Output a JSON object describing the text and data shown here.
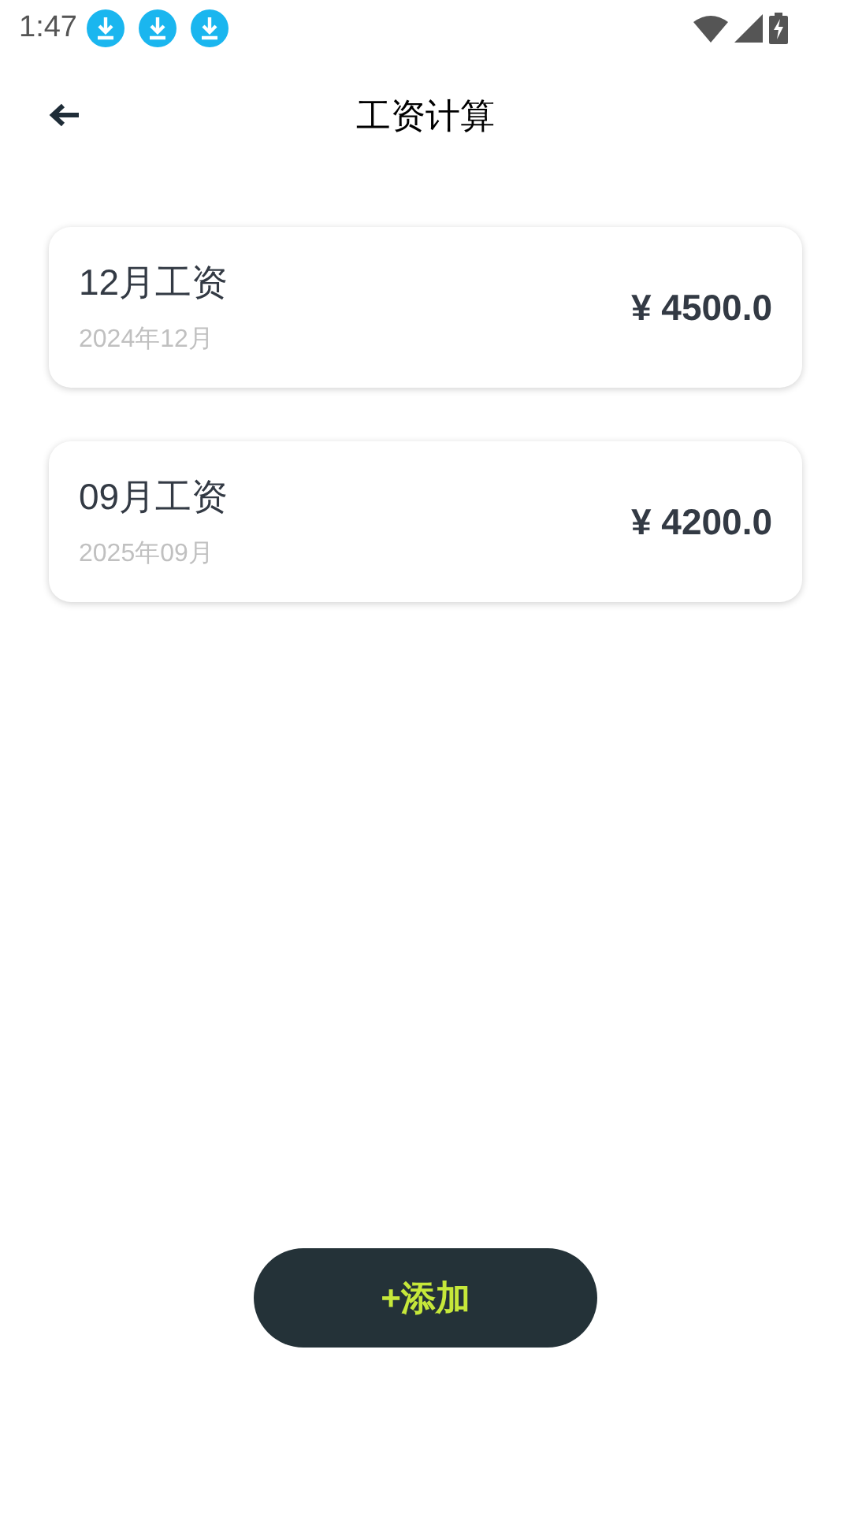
{
  "status_bar": {
    "time": "1:47",
    "notifications": [
      {
        "kind": "download"
      },
      {
        "kind": "download"
      },
      {
        "kind": "download"
      }
    ]
  },
  "header": {
    "title": "工资计算"
  },
  "salaries": [
    {
      "title": "12月工资",
      "date": "2024年12月",
      "amount": "¥ 4500.0"
    },
    {
      "title": "09月工资",
      "date": "2025年09月",
      "amount": "¥ 4200.0"
    }
  ],
  "add_button": {
    "label": "+添加"
  }
}
